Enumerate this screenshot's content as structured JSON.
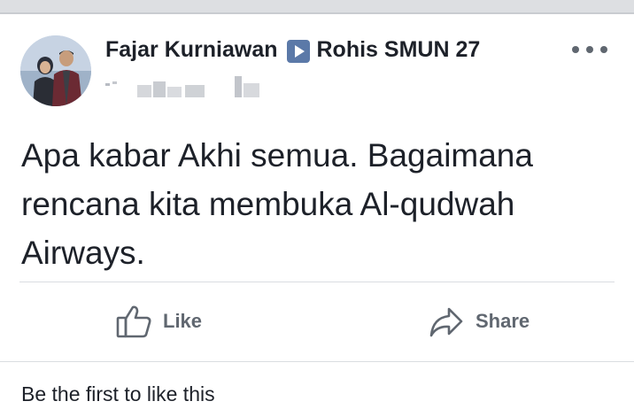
{
  "post": {
    "author": "Fajar Kurniawan",
    "group": "Rohis SMUN 27",
    "text": "Apa kabar Akhi semua. Bagaimana rencana kita membuka Al-qudwah Airways."
  },
  "actions": {
    "like_label": "Like",
    "share_label": "Share"
  },
  "footer": {
    "likes_text": "Be the first to like this"
  },
  "icons": {
    "arrow": "play-arrow-icon",
    "more": "more-options-icon",
    "like": "thumbs-up-icon",
    "share": "share-arrow-icon"
  },
  "colors": {
    "arrow_box": "#5b79a8",
    "action_text": "#606770",
    "divider": "#dadde1"
  }
}
